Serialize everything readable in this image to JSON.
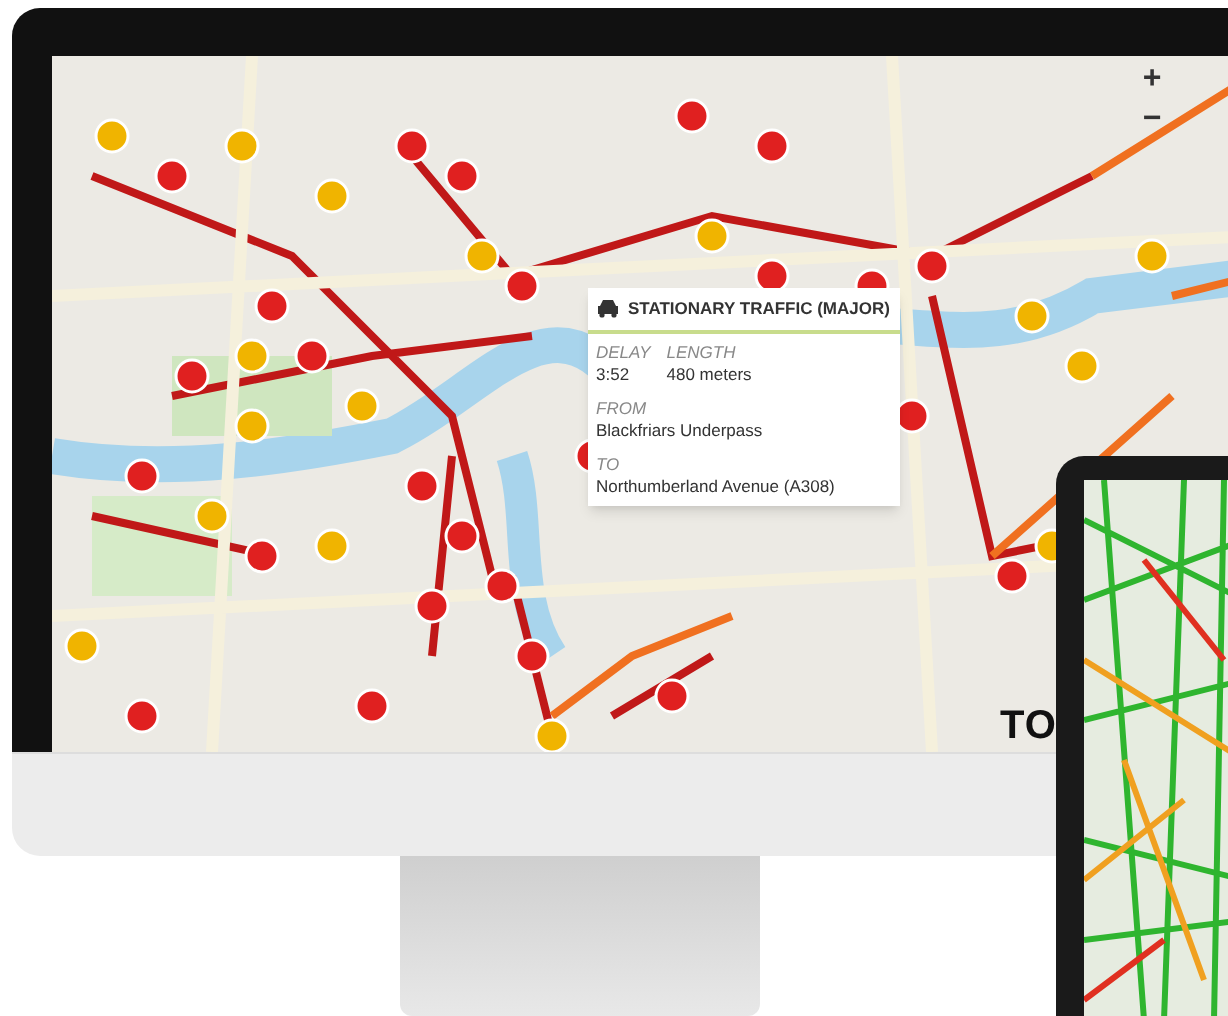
{
  "map_controls": [
    {
      "label": "+"
    },
    {
      "label": "−"
    }
  ],
  "popup": {
    "title": "STATIONARY TRAFFIC (MAJOR)",
    "fields": [
      {
        "label": "DELAY",
        "value": "3:52"
      },
      {
        "label": "LENGTH",
        "value": "480 meters"
      }
    ],
    "from": {
      "label": "FROM",
      "value": "Blackfriars Underpass"
    },
    "to": {
      "label": "TO",
      "value": "Northumberland Avenue (A308)"
    }
  },
  "logo": "TO"
}
